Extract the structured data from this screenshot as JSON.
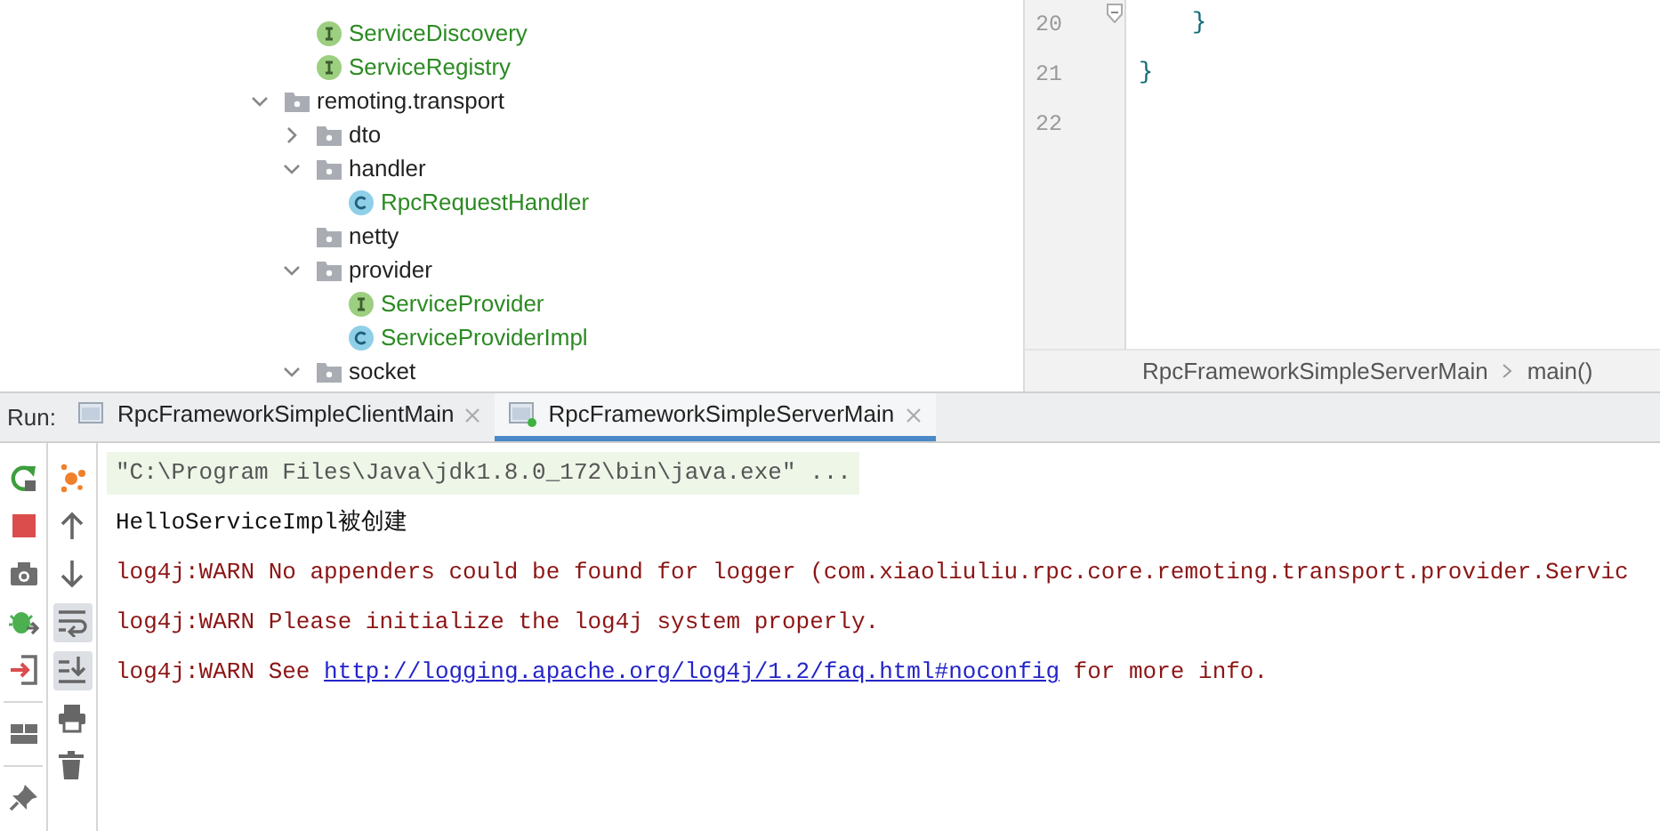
{
  "project_tree": {
    "leading_items": [
      {
        "label": "ServiceDiscovery",
        "kind": "interface"
      },
      {
        "label": "ServiceRegistry",
        "kind": "interface"
      }
    ],
    "items": [
      {
        "label": "remoting.transport",
        "kind": "package",
        "expanded": true,
        "children": [
          {
            "label": "dto",
            "kind": "package",
            "expanded": false
          },
          {
            "label": "handler",
            "kind": "package",
            "expanded": true,
            "children": [
              {
                "label": "RpcRequestHandler",
                "kind": "class"
              }
            ]
          },
          {
            "label": "netty",
            "kind": "package"
          },
          {
            "label": "provider",
            "kind": "package",
            "expanded": true,
            "children": [
              {
                "label": "ServiceProvider",
                "kind": "interface"
              },
              {
                "label": "ServiceProviderImpl",
                "kind": "class"
              }
            ]
          },
          {
            "label": "socket",
            "kind": "package",
            "expanded": true
          }
        ]
      }
    ]
  },
  "editor": {
    "lines": [
      {
        "number": "20",
        "code": "}",
        "indent": true,
        "fold": true
      },
      {
        "number": "21",
        "code": "}",
        "indent": false,
        "fold": false
      },
      {
        "number": "22",
        "fold": false
      }
    ],
    "breadcrumb": [
      "RpcFrameworkSimpleServerMain",
      "main()"
    ]
  },
  "run_panel": {
    "label": "Run:",
    "tabs": [
      {
        "label": "RpcFrameworkSimpleClientMain",
        "selected": false,
        "running": false
      },
      {
        "label": "RpcFrameworkSimpleServerMain",
        "selected": true,
        "running": true
      }
    ],
    "left_toolbar": [
      {
        "kind": "rerun"
      },
      {
        "kind": "stop"
      },
      {
        "kind": "camera"
      },
      {
        "kind": "bug"
      },
      {
        "kind": "exit"
      },
      {
        "kind": "layout",
        "separator": true
      },
      {
        "kind": "pin",
        "separator": true
      }
    ],
    "right_toolbar": [
      {
        "kind": "spark",
        "on": false
      },
      {
        "kind": "up",
        "on": false
      },
      {
        "kind": "down",
        "on": false
      },
      {
        "kind": "wrap",
        "on": true
      },
      {
        "kind": "scroll_end",
        "on": true
      },
      {
        "kind": "print",
        "on": false
      },
      {
        "kind": "trash",
        "on": false
      }
    ],
    "console": [
      {
        "kind": "command",
        "parts": [
          {
            "text": "\"C:\\Program Files\\Java\\jdk1.8.0_172\\bin\\java.exe\" ..."
          }
        ]
      },
      {
        "kind": "stdout",
        "parts": [
          {
            "text": "HelloServiceImpl被创建"
          }
        ]
      },
      {
        "kind": "stderr",
        "parts": [
          {
            "text": "log4j:WARN No appenders could be found for logger (com.xiaoliuliu.rpc.core.remoting.transport.provider.Servic"
          }
        ]
      },
      {
        "kind": "stderr",
        "parts": [
          {
            "text": "log4j:WARN Please initialize the log4j system properly."
          }
        ]
      },
      {
        "kind": "stderr",
        "parts": [
          {
            "text": "log4j:WARN See "
          },
          {
            "text": "http://logging.apache.org/log4j/1.2/faq.html#noconfig",
            "link": true
          },
          {
            "text": " for more info."
          }
        ]
      }
    ]
  }
}
